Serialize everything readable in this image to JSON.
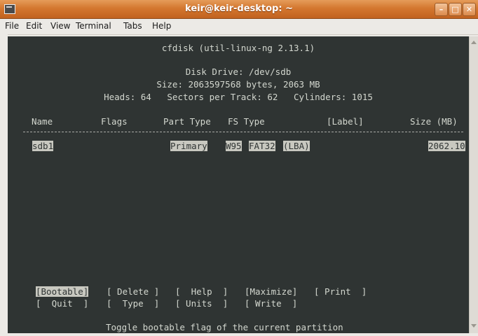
{
  "window": {
    "title": "keir@keir-desktop: ~"
  },
  "menu": [
    "File",
    "Edit",
    "View",
    "Terminal",
    "Tabs",
    "Help"
  ],
  "cfdisk": {
    "header": "cfdisk (util-linux-ng 2.13.1)",
    "disk_drive": "Disk Drive: /dev/sdb",
    "size": "Size: 2063597568 bytes, 2063 MB",
    "geometry": "Heads: 64   Sectors per Track: 62   Cylinders: 1015",
    "columns": {
      "name": "Name",
      "flags": "Flags",
      "part_type": "Part Type",
      "fs_type": "FS Type",
      "label": "[Label]",
      "size": "Size (MB)"
    },
    "partitions": [
      {
        "name": "sdb1",
        "part_type": "Primary",
        "fs1": "W95",
        "fs2": "FAT32",
        "fs3": "(LBA)",
        "size": "2062.10"
      }
    ],
    "buttons_row1": [
      "[Bootable]",
      "[ Delete ]",
      "[  Help  ]",
      "[Maximize]",
      "[ Print  ]"
    ],
    "buttons_row2": [
      "[  Quit  ]",
      "[  Type  ]",
      "[ Units  ]",
      "[ Write  ]"
    ],
    "status": "Toggle bootable flag of the current partition"
  }
}
